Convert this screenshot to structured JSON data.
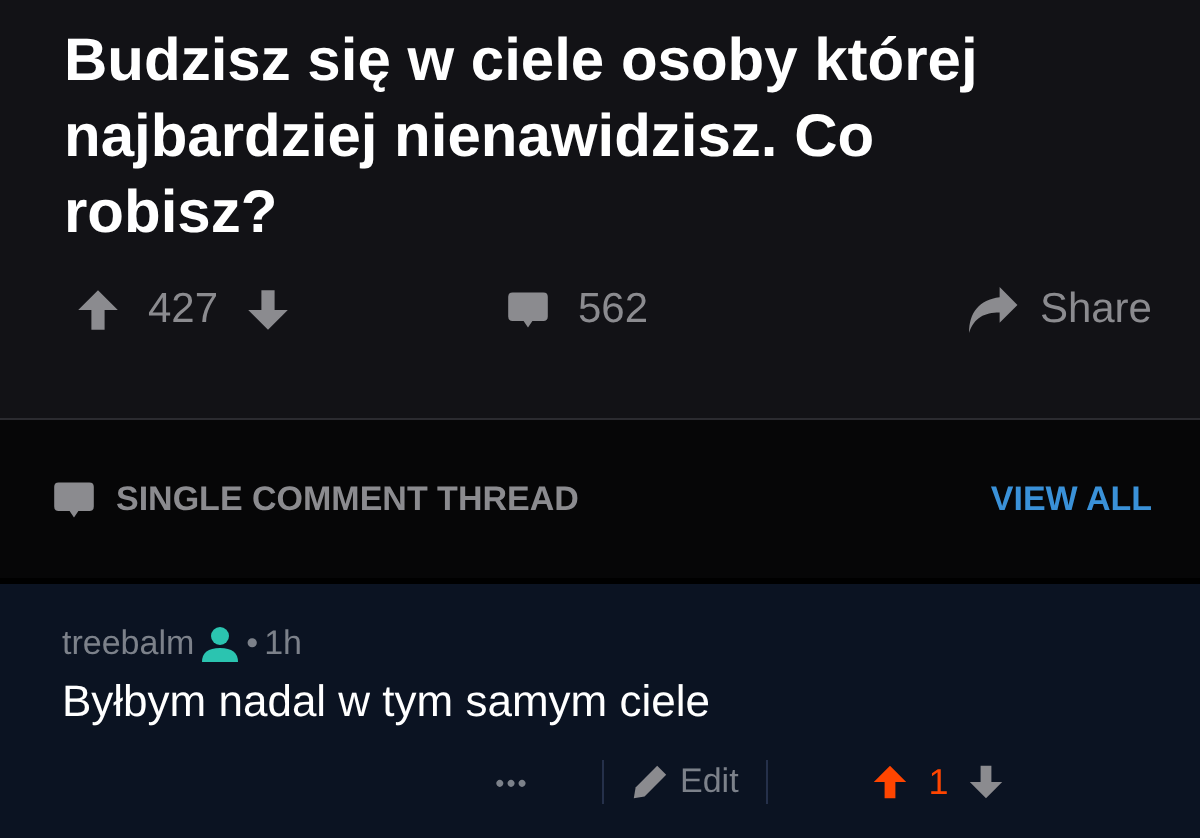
{
  "post": {
    "title": "Budzisz się w ciele osoby której najbardziej nienawidzisz. Co robisz?",
    "score": "427",
    "upvoted": false,
    "comments": "562",
    "share": "Share"
  },
  "thread_bar": {
    "label": "SINGLE COMMENT THREAD",
    "link": "VIEW ALL"
  },
  "comment": {
    "author": "treebalm",
    "separator": "•",
    "age": "1h",
    "text": "Byłbym nadal w tym samym ciele",
    "more": "•••",
    "edit": "Edit",
    "score": "1",
    "upvoted": true
  }
}
